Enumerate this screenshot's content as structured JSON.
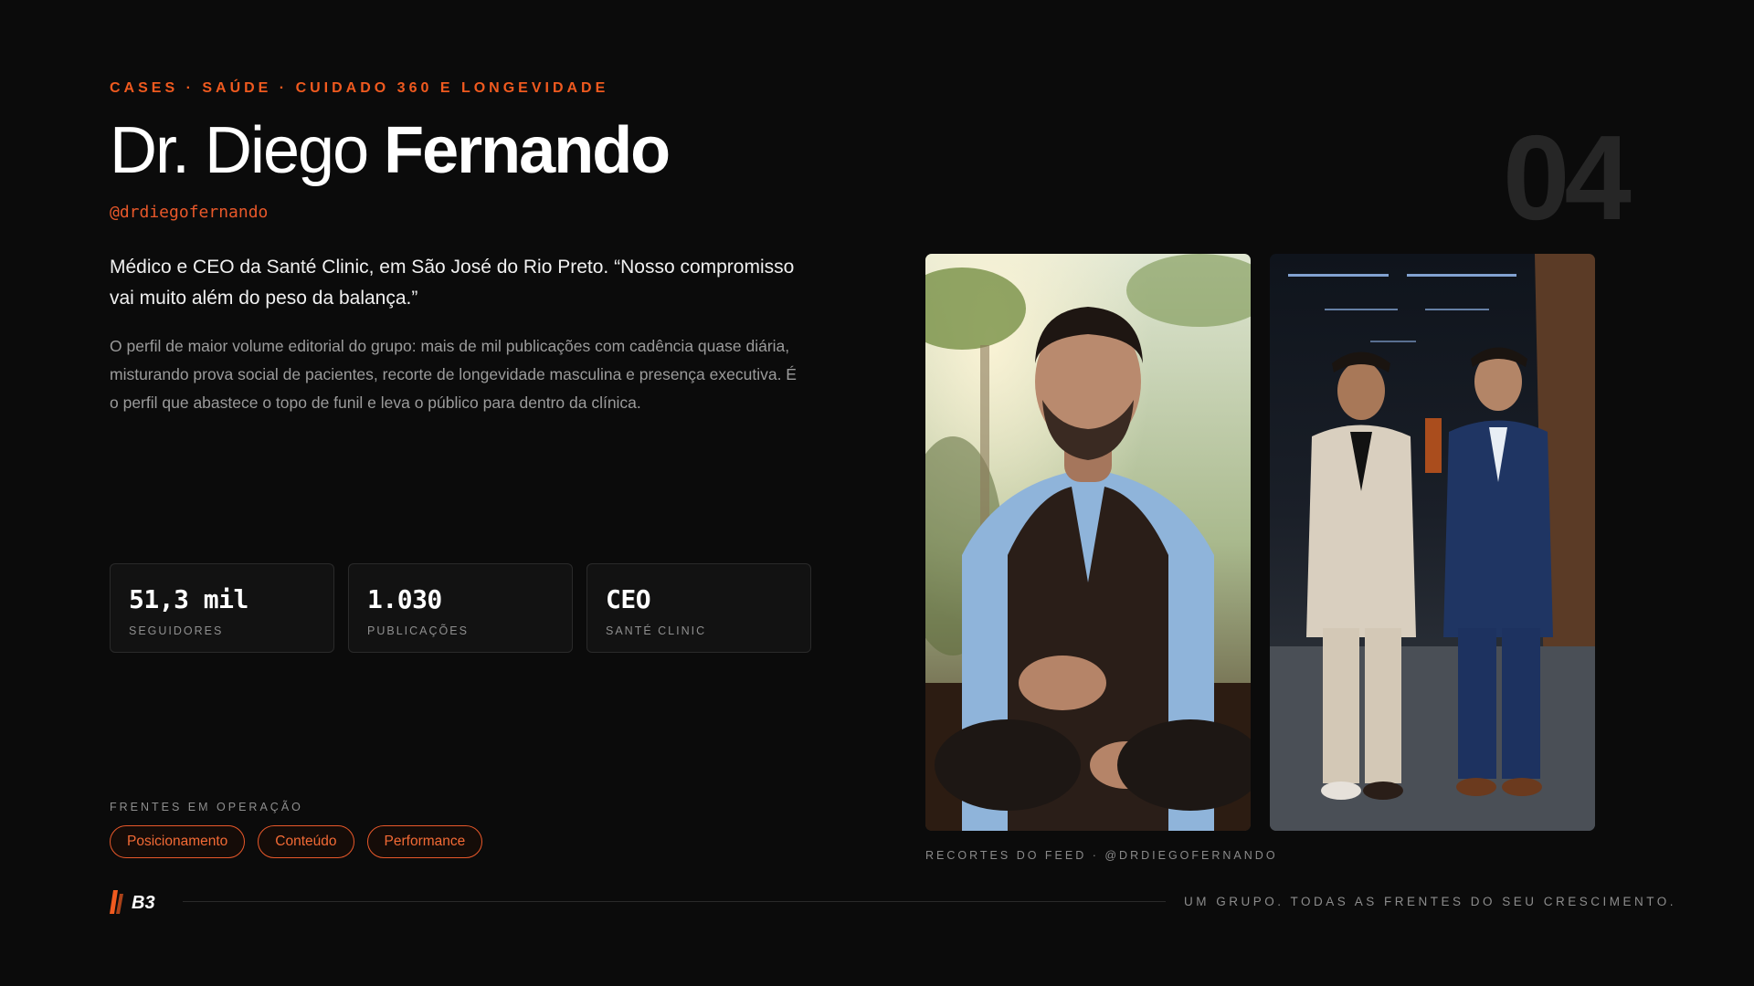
{
  "eyebrow": "CASES · SAÚDE · CUIDADO 360 E LONGEVIDADE",
  "title": {
    "light": "Dr. Diego ",
    "bold": "Fernando"
  },
  "handle": "@drdiegofernando",
  "case_number": "04",
  "lead": "Médico e CEO da Santé Clinic, em São José do Rio Preto. “Nosso compromisso vai muito além do peso da balança.”",
  "description": "O perfil de maior volume editorial do grupo: mais de mil publicações com cadência quase diária, misturando prova social de pacientes, recorte de longevidade masculina e presença executiva. É o perfil que abastece o topo de funil e leva o público para dentro da clínica.",
  "stats": [
    {
      "value": "51,3 mil",
      "label": "SEGUIDORES"
    },
    {
      "value": "1.030",
      "label": "PUBLICAÇÕES"
    },
    {
      "value": "CEO",
      "label": "SANTÉ CLINIC"
    }
  ],
  "fronts": {
    "label": "FRENTES EM OPERAÇÃO",
    "tags": [
      "Posicionamento",
      "Conteúdo",
      "Performance"
    ]
  },
  "feed": {
    "caption": "RECORTES DO FEED · @DRDIEGOFERNANDO",
    "photos": [
      "doctor-video-frame-photo",
      "two-men-corridor-photo"
    ]
  },
  "footer": {
    "logo_text": "B3",
    "tagline": "UM GRUPO. TODAS AS FRENTES DO SEU CRESCIMENTO."
  },
  "colors": {
    "accent": "#f05a1f",
    "background": "#0b0b0b",
    "card_border": "#2a2a2a",
    "muted_number": "#262626"
  }
}
